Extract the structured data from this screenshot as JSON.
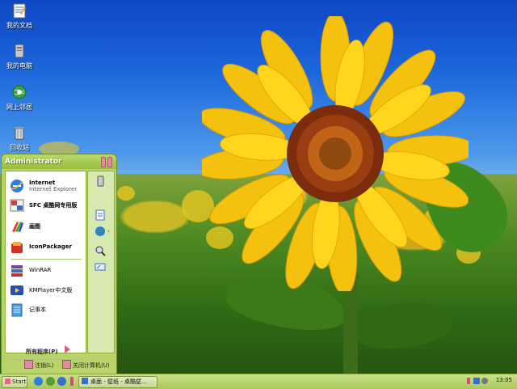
{
  "desktop": {
    "icons": [
      {
        "label": "我的文档",
        "icon": "my-documents-icon"
      },
      {
        "label": "我的电脑",
        "icon": "my-computer-icon"
      },
      {
        "label": "网上邻居",
        "icon": "network-places-icon"
      },
      {
        "label": "回收站",
        "icon": "recycle-bin-icon"
      }
    ]
  },
  "start_menu": {
    "user": "Administrator",
    "pinned": [
      {
        "title": "Internet",
        "subtitle": "Internet Explorer",
        "icon": "internet-explorer-icon"
      },
      {
        "title": "SFC 桌酷网专用版",
        "icon": "sfc-icon"
      },
      {
        "title": "画图",
        "icon": "paint-icon"
      },
      {
        "title": "IconPackager",
        "icon": "iconpackager-icon"
      }
    ],
    "recent": [
      {
        "title": "WinRAR",
        "icon": "winrar-icon"
      },
      {
        "title": "KMPlayer中文版",
        "icon": "kmplayer-icon"
      },
      {
        "title": "记事本",
        "icon": "notepad-icon"
      }
    ],
    "all_programs": "所有程序(P)",
    "logoff": "注销(L)",
    "shutdown": "关闭计算机(U)",
    "right_icons": [
      "my-computer-icon",
      "document-icon",
      "network-icon",
      "search-icon",
      "run-icon"
    ]
  },
  "taskbar": {
    "start": "Start",
    "task": "桌面 - 壁纸 - 桌酷壁...",
    "clock": "13:05"
  },
  "colors": {
    "theme_green": "#b8d36a",
    "accent_pink": "#e08ba0"
  }
}
